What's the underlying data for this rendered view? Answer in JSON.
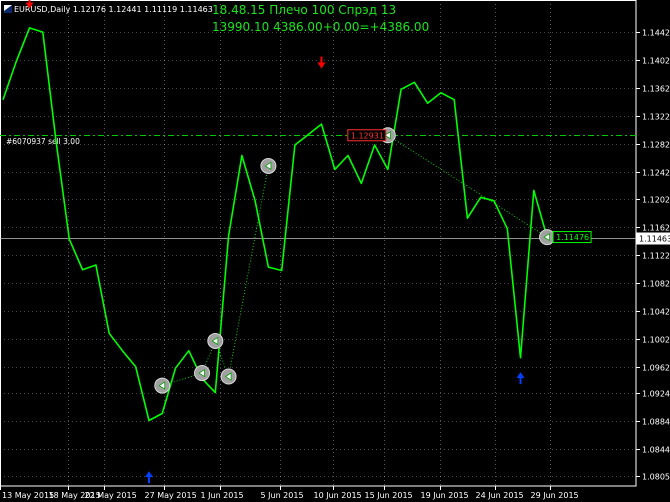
{
  "header": {
    "symbol_info": "EURUSD,Daily  1.12176 1.12441 1.11119 1.11463"
  },
  "overlay": {
    "line1": "18.48.15 Плечо 100 Спрэд 13",
    "line2": "13990.10 4386.00+0.00=+4386.00"
  },
  "order_line": {
    "label": "#6070937 sell 3.00",
    "price": 1.1295
  },
  "open_price_tag": "1.12931",
  "close_price_tag": "1.11476",
  "current_price": "1.11463",
  "colors": {
    "background": "#000000",
    "price_line": "#00ff00",
    "grid": "#ffffff",
    "order_line": "#00c800",
    "sell_arrow": "#ff0000",
    "buy_arrow": "#0040ff",
    "marker": "#a0a0a0",
    "current_price_box": "#ffffff"
  },
  "chart_data": {
    "type": "line",
    "title": "EURUSD,Daily",
    "y_ticks": [
      "1.14420",
      "1.14020",
      "1.13620",
      "1.13220",
      "1.12820",
      "1.12420",
      "1.12020",
      "1.11620",
      "1.11220",
      "1.10820",
      "1.10420",
      "1.10020",
      "1.09620",
      "1.09240",
      "1.08840",
      "1.08440",
      "1.08050"
    ],
    "x_ticks": [
      "13 May 2015",
      "18 May 2015",
      "22 May 2015",
      "27 May 2015",
      "1 Jun 2015",
      "5 Jun 2015",
      "10 Jun 2015",
      "15 Jun 2015",
      "19 Jun 2015",
      "24 Jun 2015",
      "29 Jun 2015"
    ],
    "ylim": [
      1.0791,
      1.1488
    ],
    "series": [
      {
        "values": [
          1.1345,
          1.14,
          1.1448,
          1.1442,
          1.1285,
          1.1145,
          1.1101,
          1.1108,
          1.101,
          1.0985,
          1.0962,
          1.0885,
          1.0895,
          1.096,
          1.0985,
          1.0945,
          1.0925,
          1.115,
          1.1265,
          1.12,
          1.1105,
          1.11,
          1.128,
          1.1295,
          1.131,
          1.1245,
          1.1265,
          1.1225,
          1.128,
          1.1245,
          1.136,
          1.137,
          1.134,
          1.1355,
          1.1345,
          1.1175,
          1.1205,
          1.12,
          1.116,
          1.0975,
          1.1215,
          1.1148
        ]
      }
    ],
    "markers": [
      {
        "type": "sell_arrow",
        "index": 2,
        "price": 1.148
      },
      {
        "type": "buy_arrow",
        "index": 11,
        "price": 1.0808
      },
      {
        "type": "sell_arrow",
        "index": 24,
        "price": 1.1394
      },
      {
        "type": "buy_arrow",
        "index": 39,
        "price": 1.095
      },
      {
        "type": "circle",
        "index": 12,
        "price": 1.0935
      },
      {
        "type": "circle",
        "index": 15,
        "price": 1.0953
      },
      {
        "type": "circle",
        "index": 16,
        "price": 1.0999
      },
      {
        "type": "circle",
        "index": 17,
        "price": 1.0948
      },
      {
        "type": "circle",
        "index": 20,
        "price": 1.125
      },
      {
        "type": "circle",
        "index": 29,
        "price": 1.1294
      },
      {
        "type": "circle",
        "index": 41,
        "price": 1.1148
      }
    ],
    "grid": true
  }
}
